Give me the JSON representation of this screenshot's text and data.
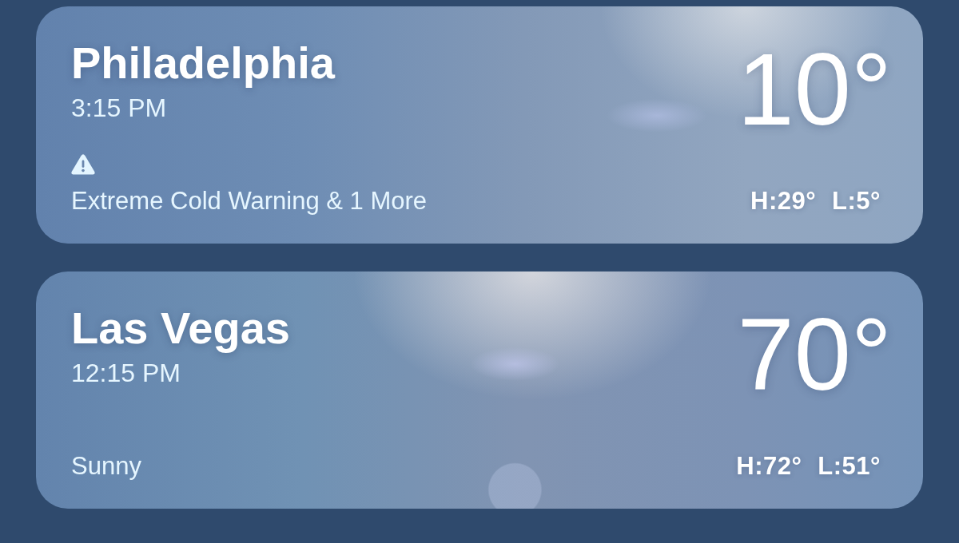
{
  "locations": [
    {
      "city": "Philadelphia",
      "time": "3:15 PM",
      "kind": "alert",
      "summary": "Extreme Cold Warning & 1 More",
      "temperature": "10°",
      "high": "H:29°",
      "low": "L:5°"
    },
    {
      "city": "Las Vegas",
      "time": "12:15 PM",
      "kind": "condition",
      "summary": "Sunny",
      "temperature": "70°",
      "high": "H:72°",
      "low": "L:51°"
    }
  ]
}
